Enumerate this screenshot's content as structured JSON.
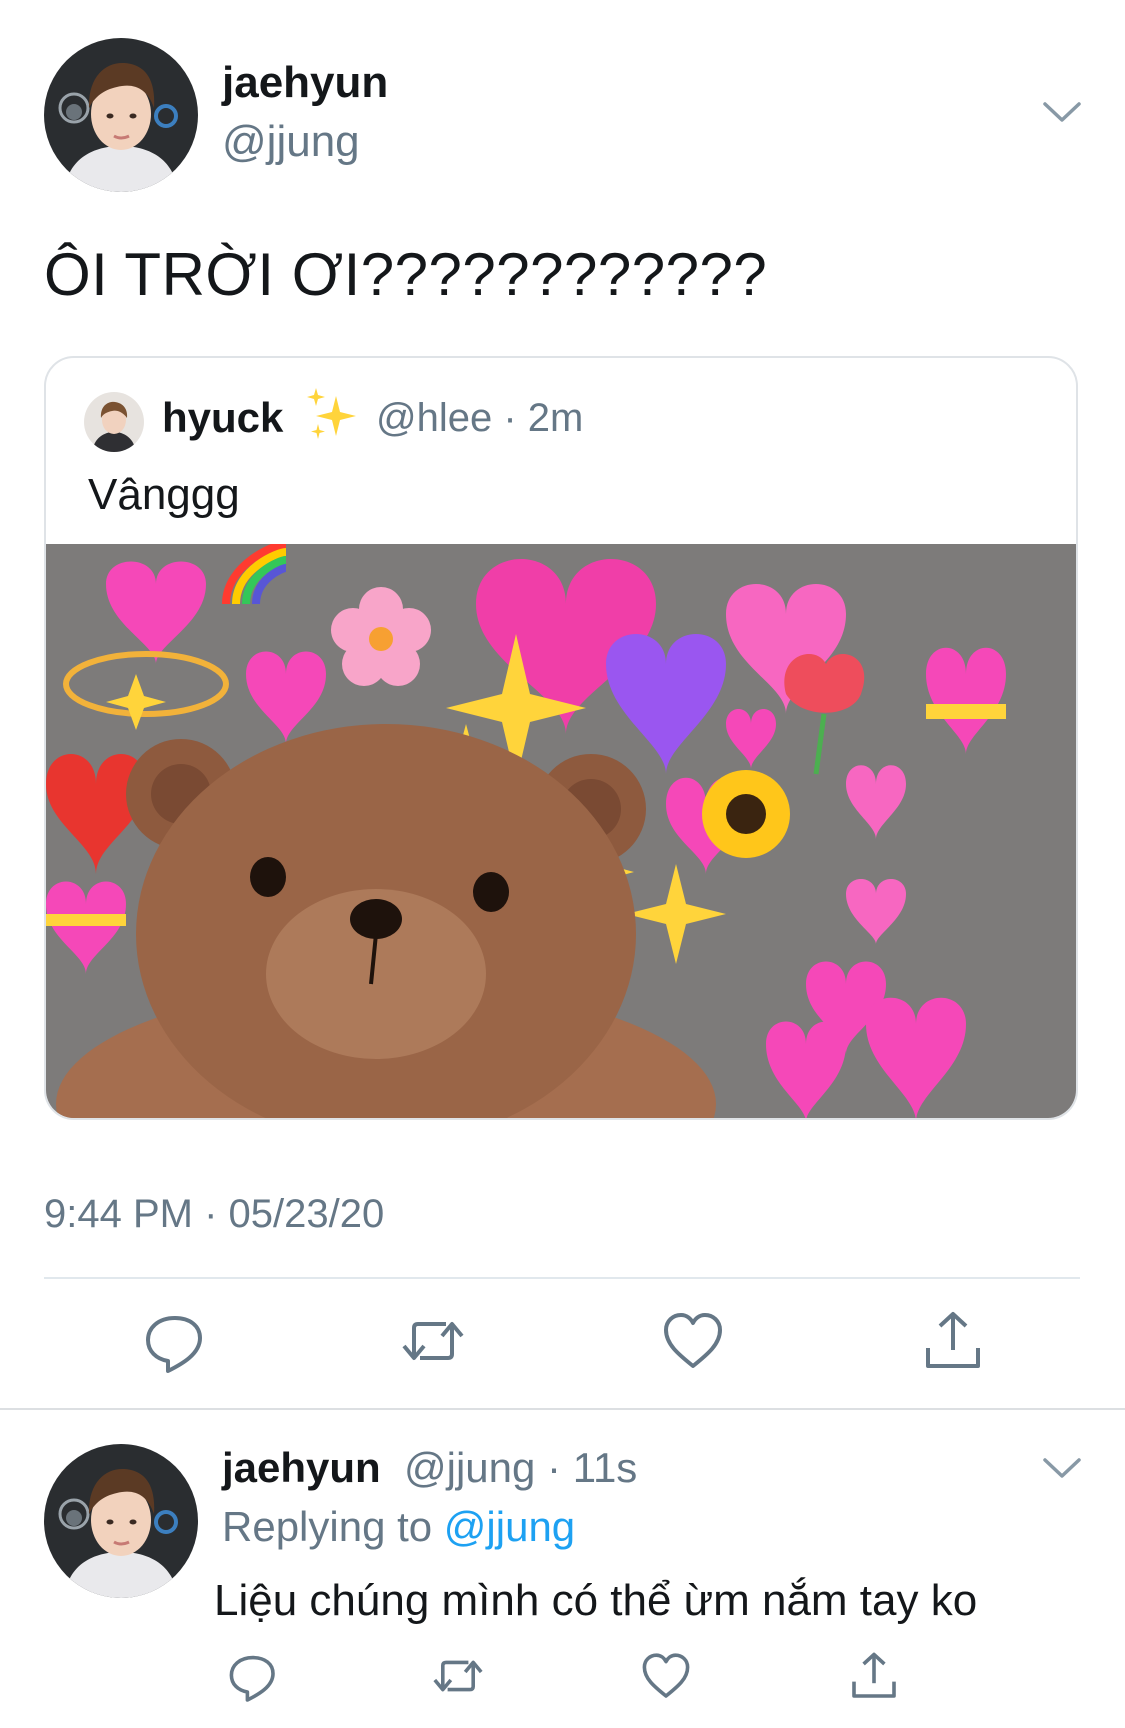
{
  "main_tweet": {
    "display_name": "jaehyun",
    "handle": "@jjung",
    "text": "ÔI TRỜI ƠI????????????",
    "timestamp": "9:44 PM · 05/23/20"
  },
  "quoted_tweet": {
    "display_name": "hyuck",
    "handle_time": "@hlee · 2m",
    "text": "Vânggg",
    "media": "teddy-bear-hearts-image"
  },
  "reply": {
    "display_name": "jaehyun",
    "handle_time": "@jjung · 11s",
    "replying_prefix": "Replying to",
    "replying_handle": "@jjung",
    "text": "Liệu chúng mình có thể ừm nắm tay ko"
  },
  "icons": {
    "menu": "chevron-down-icon",
    "reply": "comment-icon",
    "retweet": "retweet-icon",
    "like": "heart-icon",
    "share": "share-icon",
    "verified_emoji": "sparkles-icon"
  },
  "colors": {
    "text_primary": "#14171a",
    "text_secondary": "#657786",
    "link": "#1da1f2",
    "divider": "#e1e8ed"
  }
}
